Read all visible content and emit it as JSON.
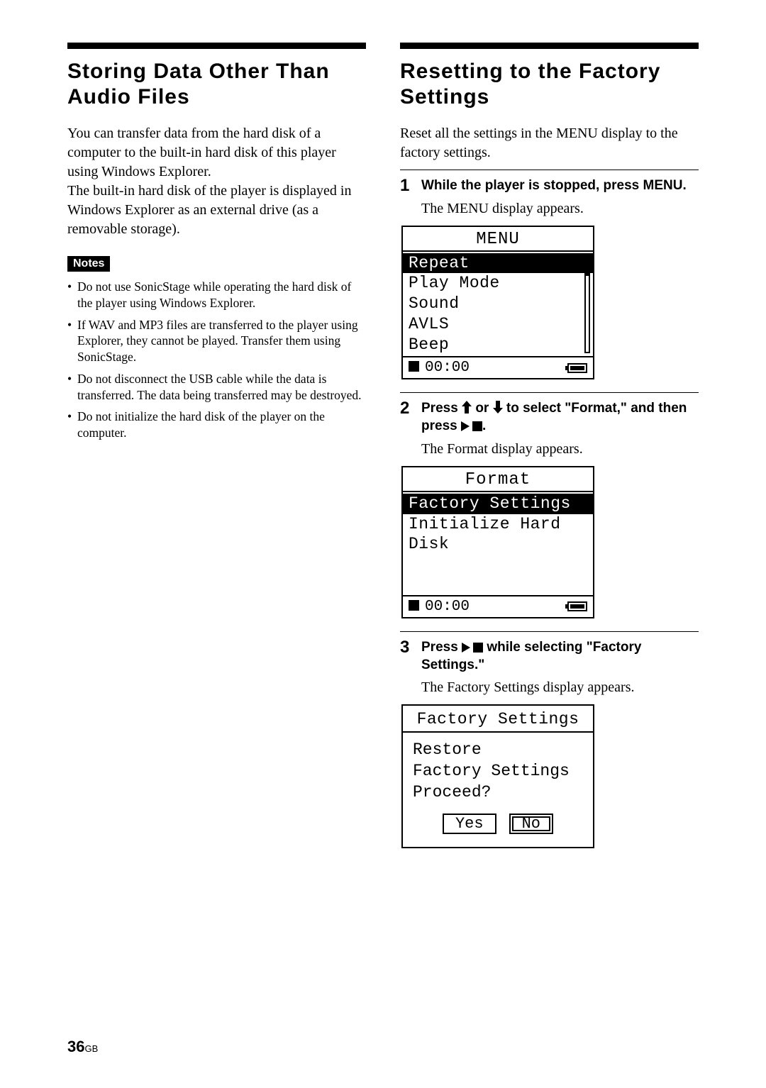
{
  "left": {
    "heading": "Storing Data Other Than Audio Files",
    "para": "You can transfer data from the hard disk of a computer to the built-in hard disk of this player using Windows Explorer.\nThe built-in hard disk of the player is displayed in Windows Explorer as an external drive (as a removable storage).",
    "notes_label": "Notes",
    "notes": [
      "Do not use SonicStage while operating the hard disk of the player using Windows Explorer.",
      "If WAV and MP3 files are transferred to the player using Explorer, they cannot be played. Transfer them using SonicStage.",
      "Do not disconnect the USB cable while the data is transferred. The data being transferred may be destroyed.",
      "Do not initialize the hard disk of the player on the computer."
    ]
  },
  "right": {
    "heading": "Resetting to the Factory Settings",
    "para": "Reset all the settings in the MENU display to the factory settings.",
    "steps": [
      {
        "num": "1",
        "title": "While the player is stopped, press MENU.",
        "desc": "The MENU display appears.",
        "screen": {
          "type": "menu",
          "header": "MENU",
          "items": [
            "Repeat",
            "Play Mode",
            "Sound",
            "AVLS",
            "Beep"
          ],
          "selected": 0,
          "time": "00:00"
        }
      },
      {
        "num": "2",
        "title_pre": "Press ",
        "title_mid": " or ",
        "title_post": " to select \"Format,\" and then press ",
        "title_end": ".",
        "desc": "The Format display appears.",
        "screen": {
          "type": "menu",
          "header": "Format",
          "items": [
            "Factory Settings",
            "Initialize Hard Disk"
          ],
          "selected": 0,
          "time": "00:00",
          "tall": true
        }
      },
      {
        "num": "3",
        "title_pre": "Press ",
        "title_post": " while selecting \"Factory Settings.\"",
        "desc": "The Factory Settings display appears.",
        "screen": {
          "type": "dialog",
          "header": "Factory Settings",
          "body": "Restore\nFactory Settings\nProceed?",
          "buttons": [
            "Yes",
            "No"
          ],
          "focus": 1
        }
      }
    ]
  },
  "page": {
    "num": "36",
    "suffix": "GB"
  }
}
